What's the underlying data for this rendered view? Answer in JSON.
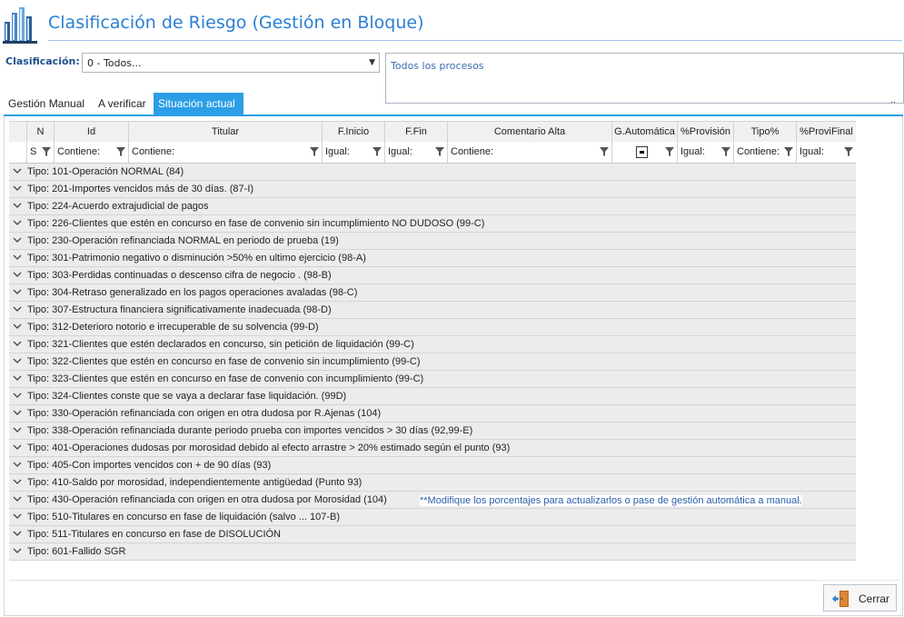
{
  "window": {
    "title": "Clasificación de Riesgo (Gestión en Bloque)"
  },
  "filter": {
    "label": "Clasificación:",
    "selected": "0 - Todos...",
    "description": "Todos los procesos",
    "more": ".."
  },
  "tabs": [
    {
      "label": "Gestión Manual",
      "active": false
    },
    {
      "label": "A verificar",
      "active": false
    },
    {
      "label": "Situación actual",
      "active": true
    }
  ],
  "grid": {
    "columns": [
      "N",
      "Id",
      "Titular",
      "F.Inicio",
      "F.Fin",
      "Comentario Alta",
      "G.Automática",
      "%Provisión",
      "Tipo%",
      "%ProviFinal"
    ],
    "filters": [
      "S",
      "Contiene:",
      "Contiene:",
      "Igual:",
      "Igual:",
      "Contiene:",
      "",
      "Igual:",
      "Contiene:",
      "Igual:"
    ],
    "groups": [
      "Tipo: 101-Operación NORMAL (84)",
      "Tipo: 201-Importes vencidos más de 30 días. (87-I)",
      "Tipo: 224-Acuerdo extrajudicial de pagos",
      "Tipo: 226-Clientes que estén en concurso en fase de convenio sin incumplimiento NO DUDOSO (99-C)",
      "Tipo: 230-Operación refinanciada NORMAL en periodo de prueba (19)",
      "Tipo: 301-Patrimonio negativo o disminución >50% en ultimo ejercicio (98-A)",
      "Tipo: 303-Perdidas continuadas o descenso cifra de negocio . (98-B)",
      "Tipo: 304-Retraso generalizado en los pagos operaciones avaladas (98-C)",
      "Tipo: 307-Estructura  financiera significativamente inadecuada (98-D)",
      "Tipo: 312-Deterioro notorio e irrecuperable de su solvencia (99-D)",
      "Tipo: 321-Clientes que estén declarados en concurso, sin petición de liquidación (99-C)",
      "Tipo: 322-Clientes que estén en concurso en fase de convenio sin incumplimiento (99-C)",
      "Tipo: 323-Clientes que estén en concurso en fase de convenio con incumplimiento (99-C)",
      "Tipo: 324-Clientes conste que se vaya a declarar fase liquidación. (99D)",
      "Tipo: 330-Operación refinanciada con origen en otra dudosa por R.Ajenas (104)",
      "Tipo: 338-Operación refinanciada durante periodo prueba con importes vencidos > 30 días (92,99-E)",
      "Tipo: 401-Operaciones dudosas por morosidad debido al efecto arrastre > 20% estimado según el punto (93)",
      "Tipo: 405-Con importes vencidos con + de 90 días (93)",
      "Tipo: 410-Saldo por morosidad, independientemente antigüedad  (Punto 93)",
      "Tipo: 430-Operación refinanciada con origen en otra dudosa por Morosidad (104)",
      "Tipo: 510-Titulares en concurso en fase de liquidación (salvo ... 107-B)",
      "Tipo: 511-Titulares en concurso en fase de  DISOLUCIÓN",
      "Tipo: 601-Fallido SGR"
    ]
  },
  "note": "**Modifique los porcentajes para actualizarlos o pase de gestión automática a manual.",
  "footer": {
    "close_label": "Cerrar"
  },
  "colors": {
    "accent": "#2b9ee6",
    "title": "#2a7fd4",
    "group_bg": "#ececec"
  }
}
